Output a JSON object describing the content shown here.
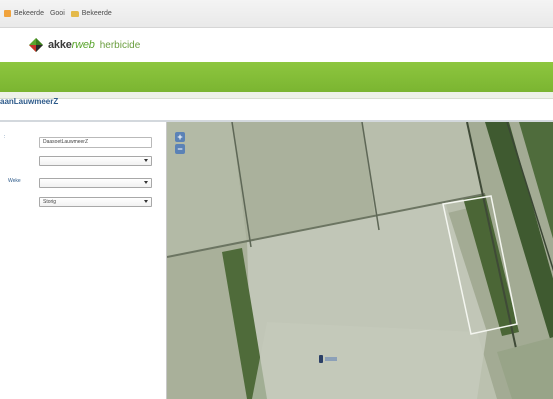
{
  "browser": {
    "bookmarks": [
      {
        "label": "Bekeerde",
        "icon": "bookmark-icon"
      },
      {
        "label": "Gooi",
        "icon": "bookmark-icon"
      },
      {
        "label": "Bekeerde",
        "icon": "folder-icon"
      }
    ]
  },
  "header": {
    "logo_text_dark": "akke",
    "logo_text_green": "rweb",
    "subtitle": "herbicide"
  },
  "page": {
    "title": "aanLauwmeerZ"
  },
  "form": {
    "field_name_value": "DaasoetLauwmeerZ",
    "select1_value": "",
    "select2_label": "Weke",
    "select2_value": "",
    "select3_value": "Storig"
  },
  "map": {
    "zoom_in": "+",
    "zoom_out": "−"
  },
  "colors": {
    "brand_green": "#8dc63f",
    "link_blue": "#2d5a8a",
    "zoom_blue": "#5b82b6"
  }
}
